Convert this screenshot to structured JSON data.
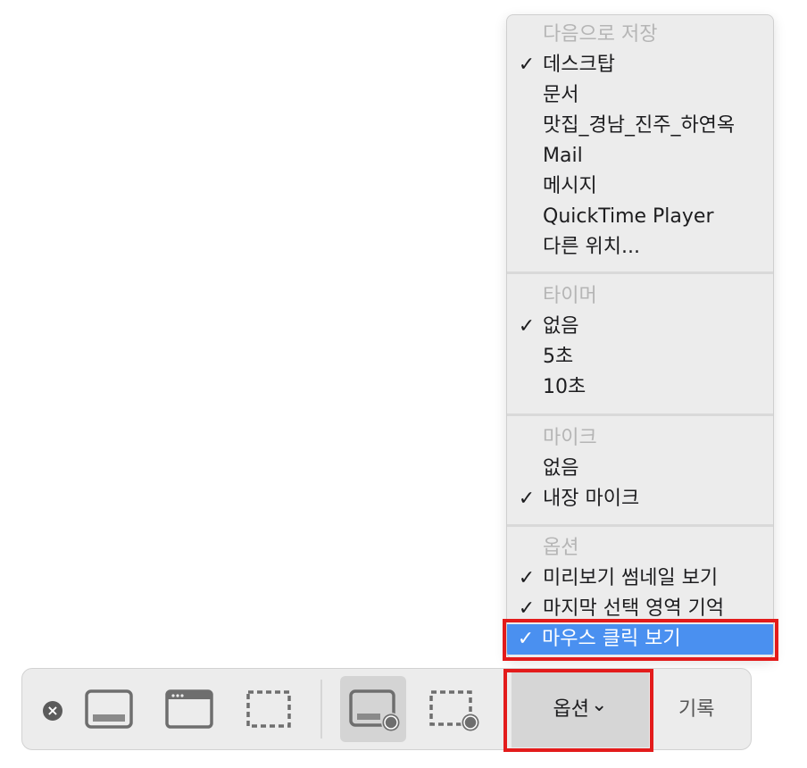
{
  "menu": {
    "sections": [
      {
        "header": "다음으로 저장",
        "items": [
          {
            "label": "데스크탑",
            "checked": true
          },
          {
            "label": "문서",
            "checked": false
          },
          {
            "label": "맛집_경남_진주_하연옥",
            "checked": false
          },
          {
            "label": "Mail",
            "checked": false
          },
          {
            "label": "메시지",
            "checked": false
          },
          {
            "label": "QuickTime Player",
            "checked": false
          },
          {
            "label": "다른 위치...",
            "checked": false
          }
        ]
      },
      {
        "header": "타이머",
        "items": [
          {
            "label": "없음",
            "checked": true
          },
          {
            "label": "5초",
            "checked": false
          },
          {
            "label": "10초",
            "checked": false
          }
        ]
      },
      {
        "header": "마이크",
        "items": [
          {
            "label": "없음",
            "checked": false
          },
          {
            "label": "내장 마이크",
            "checked": true
          }
        ]
      },
      {
        "header": "옵션",
        "items": [
          {
            "label": "미리보기 썸네일 보기",
            "checked": true
          },
          {
            "label": "마지막 선택 영역 기억",
            "checked": true
          },
          {
            "label": "마우스 클릭 보기",
            "checked": true,
            "highlighted": true
          }
        ]
      }
    ],
    "checkmark": "✓"
  },
  "toolbar": {
    "close_icon": "close-icon",
    "tools": [
      {
        "name": "capture-entire-screen-icon"
      },
      {
        "name": "capture-window-icon"
      },
      {
        "name": "capture-selection-icon"
      },
      {
        "name": "record-entire-screen-icon",
        "active": true
      },
      {
        "name": "record-selection-icon"
      }
    ],
    "options_label": "옵션",
    "options_chevron": "⌄",
    "record_label": "기록"
  },
  "colors": {
    "highlight": "#4a90f0",
    "annotation_red": "#e31b1b",
    "menu_bg": "#ececec"
  }
}
